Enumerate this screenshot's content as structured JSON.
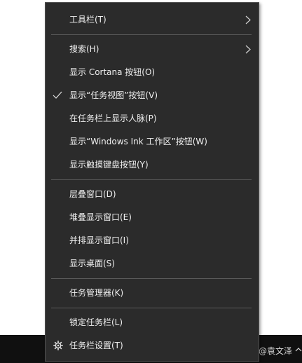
{
  "context_menu": {
    "items": [
      {
        "label": "工具栏(T)",
        "submenu": true
      },
      {
        "label": "搜索(H)",
        "submenu": true
      },
      {
        "label": "显示 Cortana 按钮(O)"
      },
      {
        "label": "显示“任务视图”按钮(V)",
        "checked": true
      },
      {
        "label": "在任务栏上显示人脉(P)"
      },
      {
        "label": "显示“Windows Ink 工作区”按钮(W)"
      },
      {
        "label": "显示触摸键盘按钮(Y)"
      },
      {
        "label": "层叠窗口(D)"
      },
      {
        "label": "堆叠显示窗口(E)"
      },
      {
        "label": "并排显示窗口(I)"
      },
      {
        "label": "显示桌面(S)"
      },
      {
        "label": "任务管理器(K)"
      },
      {
        "label": "锁定任务栏(L)"
      },
      {
        "label": "任务栏设置(T)",
        "icon": "gear-icon"
      }
    ]
  },
  "taskbar": {
    "watermark": "头条 @袁文泽"
  },
  "colors": {
    "menu_background": "#2b2b2b",
    "menu_text": "#f0f0f0",
    "separator": "#5a5a5a",
    "taskbar_background": "#101010"
  }
}
